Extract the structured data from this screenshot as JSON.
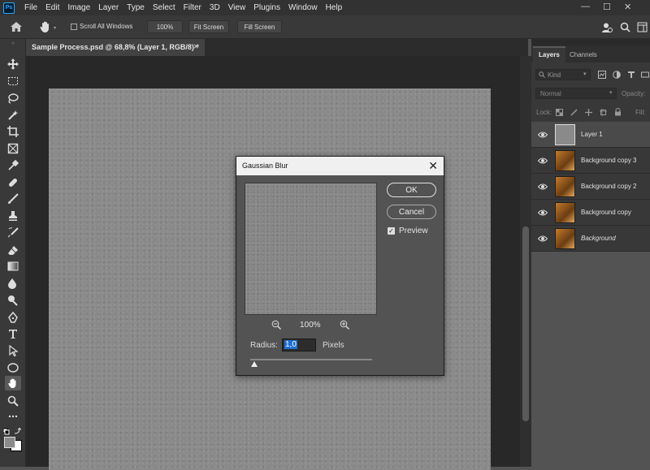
{
  "app": {
    "logo": "Ps"
  },
  "menu": [
    "File",
    "Edit",
    "Image",
    "Layer",
    "Type",
    "Select",
    "Filter",
    "3D",
    "View",
    "Plugins",
    "Window",
    "Help"
  ],
  "window_controls": {
    "minimize": "—",
    "maximize": "☐",
    "close": "✕"
  },
  "options_bar": {
    "scroll_all_label": "Scroll All Windows",
    "zoom_100": "100%",
    "fit_screen": "Fit Screen",
    "fill_screen": "Fill Screen"
  },
  "document": {
    "tab_title": "Sample Process.psd @ 68,8% (Layer 1, RGB/8) *",
    "tab_close": "✕"
  },
  "tools": [
    "move-icon",
    "marquee-icon",
    "lasso-icon",
    "magic-wand-icon",
    "crop-icon",
    "frame-icon",
    "eyedropper-icon",
    "healing-brush-icon",
    "brush-icon",
    "clone-stamp-icon",
    "history-brush-icon",
    "eraser-icon",
    "gradient-icon",
    "blur-icon",
    "dodge-icon",
    "pen-icon",
    "type-icon",
    "path-selection-icon",
    "shape-icon",
    "hand-icon",
    "zoom-icon",
    "more-icon"
  ],
  "panel": {
    "tabs": [
      "Layers",
      "Channels"
    ],
    "filter_kind": "Kind",
    "blend_mode": "Normal",
    "opacity_label": "Opacity:",
    "lock_label": "Lock:",
    "fill_label": "Fill:",
    "layers": [
      {
        "name": "Layer 1",
        "selected": true,
        "thumb": "plain"
      },
      {
        "name": "Background copy 3",
        "selected": false,
        "thumb": "image"
      },
      {
        "name": "Background copy 2",
        "selected": false,
        "thumb": "image"
      },
      {
        "name": "Background copy",
        "selected": false,
        "thumb": "image"
      },
      {
        "name": "Background",
        "selected": false,
        "thumb": "image",
        "italic": true
      }
    ]
  },
  "dialog": {
    "title": "Gaussian Blur",
    "close": "✕",
    "ok": "OK",
    "cancel": "Cancel",
    "preview_label": "Preview",
    "preview_checked": true,
    "zoom": "100%",
    "radius_label": "Radius:",
    "radius_value": "1,0",
    "unit": "Pixels"
  }
}
